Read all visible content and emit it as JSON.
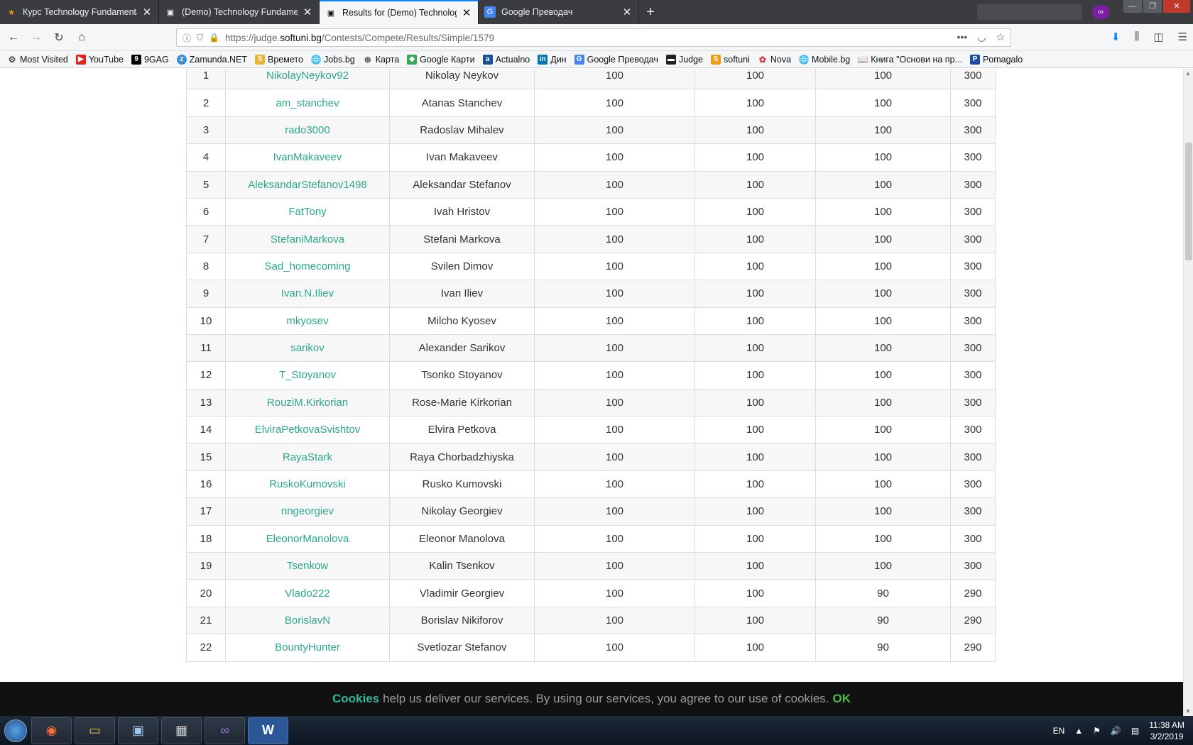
{
  "tabs": [
    {
      "title": "Курс Technology Fundamentals",
      "icon": "softuni-icon",
      "active": false
    },
    {
      "title": "(Demo) Technology Fundamentals",
      "icon": "judge-icon",
      "active": false
    },
    {
      "title": "Results for (Demo) Technology",
      "icon": "judge-icon",
      "active": true
    },
    {
      "title": "Google Преводач",
      "icon": "google-translate-icon",
      "active": false
    }
  ],
  "nav": {
    "url_prefix": "https://judge.",
    "url_domain": "softuni.bg",
    "url_path": "/Contests/Compete/Results/Simple/1579"
  },
  "bookmarks": [
    {
      "label": "Most Visited",
      "icon": "gear-icon"
    },
    {
      "label": "YouTube",
      "icon": "youtube-icon"
    },
    {
      "label": "9GAG",
      "icon": "9gag-icon"
    },
    {
      "label": "Zamunda.NET",
      "icon": "zamunda-icon"
    },
    {
      "label": "Времето",
      "icon": "weather-icon"
    },
    {
      "label": "Jobs.bg",
      "icon": "globe-icon"
    },
    {
      "label": "Карта",
      "icon": "map-icon"
    },
    {
      "label": "Google Карти",
      "icon": "google-maps-icon"
    },
    {
      "label": "Actualno",
      "icon": "actualno-icon"
    },
    {
      "label": "Дин",
      "icon": "linkedin-icon"
    },
    {
      "label": "Google Преводач",
      "icon": "google-translate-icon"
    },
    {
      "label": "Judge",
      "icon": "judge-icon"
    },
    {
      "label": "softuni",
      "icon": "softuni-icon"
    },
    {
      "label": "Nova",
      "icon": "nova-icon"
    },
    {
      "label": "Mobile.bg",
      "icon": "globe-icon"
    },
    {
      "label": "Книга \"Основи на пр...",
      "icon": "book-icon"
    },
    {
      "label": "Pomagalo",
      "icon": "pomagalo-icon"
    }
  ],
  "results": [
    {
      "rank": "1",
      "username": "NikolayNeykov92",
      "name": "Nikolay Neykov",
      "p1": "100",
      "p2": "100",
      "p3": "100",
      "total": "300"
    },
    {
      "rank": "2",
      "username": "am_stanchev",
      "name": "Atanas Stanchev",
      "p1": "100",
      "p2": "100",
      "p3": "100",
      "total": "300"
    },
    {
      "rank": "3",
      "username": "rado3000",
      "name": "Radoslav Mihalev",
      "p1": "100",
      "p2": "100",
      "p3": "100",
      "total": "300"
    },
    {
      "rank": "4",
      "username": "IvanMakaveev",
      "name": "Ivan Makaveev",
      "p1": "100",
      "p2": "100",
      "p3": "100",
      "total": "300"
    },
    {
      "rank": "5",
      "username": "AleksandarStefanov1498",
      "name": "Aleksandar Stefanov",
      "p1": "100",
      "p2": "100",
      "p3": "100",
      "total": "300"
    },
    {
      "rank": "6",
      "username": "FatTony",
      "name": "Ivah Hristov",
      "p1": "100",
      "p2": "100",
      "p3": "100",
      "total": "300"
    },
    {
      "rank": "7",
      "username": "StefaniMarkova",
      "name": "Stefani Markova",
      "p1": "100",
      "p2": "100",
      "p3": "100",
      "total": "300"
    },
    {
      "rank": "8",
      "username": "Sad_homecoming",
      "name": "Svilen Dimov",
      "p1": "100",
      "p2": "100",
      "p3": "100",
      "total": "300"
    },
    {
      "rank": "9",
      "username": "Ivan.N.Iliev",
      "name": "Ivan Iliev",
      "p1": "100",
      "p2": "100",
      "p3": "100",
      "total": "300"
    },
    {
      "rank": "10",
      "username": "mkyosev",
      "name": "Milcho Kyosev",
      "p1": "100",
      "p2": "100",
      "p3": "100",
      "total": "300"
    },
    {
      "rank": "11",
      "username": "sarikov",
      "name": "Alexander Sarikov",
      "p1": "100",
      "p2": "100",
      "p3": "100",
      "total": "300"
    },
    {
      "rank": "12",
      "username": "T_Stoyanov",
      "name": "Tsonko Stoyanov",
      "p1": "100",
      "p2": "100",
      "p3": "100",
      "total": "300"
    },
    {
      "rank": "13",
      "username": "RouziM.Kirkorian",
      "name": "Rose-Marie Kirkorian",
      "p1": "100",
      "p2": "100",
      "p3": "100",
      "total": "300"
    },
    {
      "rank": "14",
      "username": "ElviraPetkovaSvishtov",
      "name": "Elvira Petkova",
      "p1": "100",
      "p2": "100",
      "p3": "100",
      "total": "300"
    },
    {
      "rank": "15",
      "username": "RayaStark",
      "name": "Raya Chorbadzhiyska",
      "p1": "100",
      "p2": "100",
      "p3": "100",
      "total": "300"
    },
    {
      "rank": "16",
      "username": "RuskoKumovski",
      "name": "Rusko Kumovski",
      "p1": "100",
      "p2": "100",
      "p3": "100",
      "total": "300"
    },
    {
      "rank": "17",
      "username": "nngeorgiev",
      "name": "Nikolay Georgiev",
      "p1": "100",
      "p2": "100",
      "p3": "100",
      "total": "300"
    },
    {
      "rank": "18",
      "username": "EleonorManolova",
      "name": "Eleonor Manolova",
      "p1": "100",
      "p2": "100",
      "p3": "100",
      "total": "300"
    },
    {
      "rank": "19",
      "username": "Tsenkow",
      "name": "Kalin Tsenkov",
      "p1": "100",
      "p2": "100",
      "p3": "100",
      "total": "300"
    },
    {
      "rank": "20",
      "username": "Vlado222",
      "name": "Vladimir Georgiev",
      "p1": "100",
      "p2": "100",
      "p3": "90",
      "total": "290"
    },
    {
      "rank": "21",
      "username": "BorislavN",
      "name": "Borislav Nikiforov",
      "p1": "100",
      "p2": "100",
      "p3": "90",
      "total": "290"
    },
    {
      "rank": "22",
      "username": "BountyHunter",
      "name": "Svetlozar Stefanov",
      "p1": "100",
      "p2": "100",
      "p3": "90",
      "total": "290"
    }
  ],
  "cookie": {
    "highlight": "Cookies",
    "message": "help us deliver our services. By using our services, you agree to our use of cookies.",
    "ok": "OK"
  },
  "taskbar": {
    "apps": [
      "firefox-icon",
      "file-explorer-icon",
      "remote-desktop-icon",
      "calculator-icon",
      "visual-studio-icon",
      "word-icon"
    ],
    "lang": "EN",
    "time": "11:38 AM",
    "date": "3/2/2019"
  },
  "colors": {
    "username_link": "#2aa88e",
    "cookie_highlight": "#2fb89a",
    "cookie_ok": "#4bb84b",
    "active_tab_accent": "#0a84ff"
  }
}
